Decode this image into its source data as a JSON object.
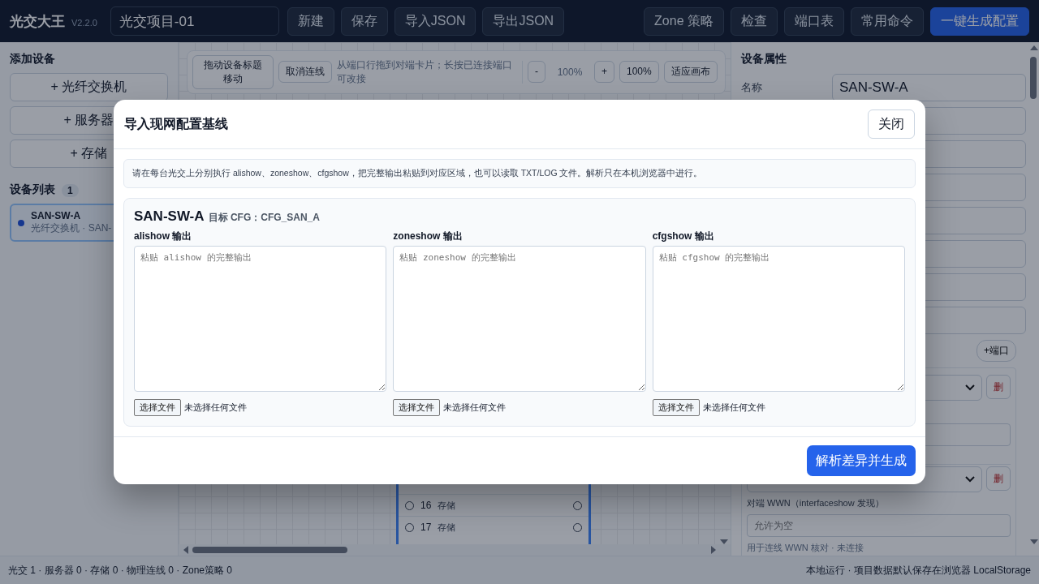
{
  "topbar": {
    "logo": "光交大王",
    "version": "V2.2.0",
    "project_name": "光交项目-01",
    "buttons_left": [
      {
        "label": "新建",
        "primary": false
      },
      {
        "label": "保存",
        "primary": false
      },
      {
        "label": "导入JSON",
        "primary": false
      },
      {
        "label": "导出JSON",
        "primary": false
      }
    ],
    "buttons_right": [
      {
        "label": "Zone 策略",
        "primary": false
      },
      {
        "label": "检查",
        "primary": false
      },
      {
        "label": "端口表",
        "primary": false
      },
      {
        "label": "常用命令",
        "primary": false
      },
      {
        "label": "一键生成配置",
        "primary": true
      }
    ]
  },
  "sidebar": {
    "add_title": "添加设备",
    "add_buttons": [
      "+  光纤交换机",
      "+  服务器",
      "+  存储"
    ],
    "list_title": "设备列表",
    "list_count": "1",
    "devices": [
      {
        "name": "SAN-SW-A",
        "subtitle": "光纤交换机 · SAN-",
        "selected": true
      }
    ]
  },
  "canvas": {
    "tools": [
      {
        "kind": "button",
        "label": "拖动设备标题移动"
      },
      {
        "kind": "button",
        "label": "取消连线"
      },
      {
        "kind": "hint",
        "label": "从端口行拖到对端卡片；长按已连接端口可改接"
      },
      {
        "kind": "divider"
      },
      {
        "kind": "button",
        "label": "-"
      },
      {
        "kind": "reading",
        "label": "100%"
      },
      {
        "kind": "button",
        "label": "+"
      },
      {
        "kind": "button",
        "label": "100%"
      },
      {
        "kind": "button",
        "label": "适应画布"
      }
    ],
    "port_rows": [
      {
        "number": "16",
        "label": "存储"
      },
      {
        "number": "17",
        "label": "存储"
      }
    ]
  },
  "properties": {
    "title": "设备属性",
    "name_label": "名称",
    "name_value": "SAN-SW-A",
    "add_port": "+端口",
    "ports": [
      {
        "delete": "删"
      },
      {
        "delete": "删",
        "wwn_label": "对端 WWN（interfaceshow 发现）",
        "wwn_placeholder": "允许为空",
        "wwn_note": "用于连线 WWN 核对 · 未连接"
      }
    ]
  },
  "status_bar": {
    "left": "光交 1 · 服务器 0 · 存储 0 · 物理连线 0 · Zone策略 0",
    "right": "本地运行 · 项目数据默认保存在浏览器 LocalStorage"
  },
  "dialog": {
    "title": "导入现网配置基线",
    "close": "关闭",
    "note": "请在每台光交上分别执行 alishow、zoneshow、cfgshow，把完整输出粘贴到对应区域，也可以读取 TXT/LOG 文件。解析只在本机浏览器中进行。",
    "device": {
      "name": "SAN-SW-A",
      "target": "目标 CFG：CFG_SAN_A",
      "inputs": [
        {
          "label": "alishow 输出",
          "placeholder": "粘贴 alishow 的完整输出",
          "file_button": "选择文件",
          "file_status": "未选择任何文件"
        },
        {
          "label": "zoneshow 输出",
          "placeholder": "粘贴 zoneshow 的完整输出",
          "file_button": "选择文件",
          "file_status": "未选择任何文件"
        },
        {
          "label": "cfgshow 输出",
          "placeholder": "粘贴 cfgshow 的完整输出",
          "file_button": "选择文件",
          "file_status": "未选择任何文件"
        }
      ]
    },
    "submit": "解析差异并生成"
  }
}
